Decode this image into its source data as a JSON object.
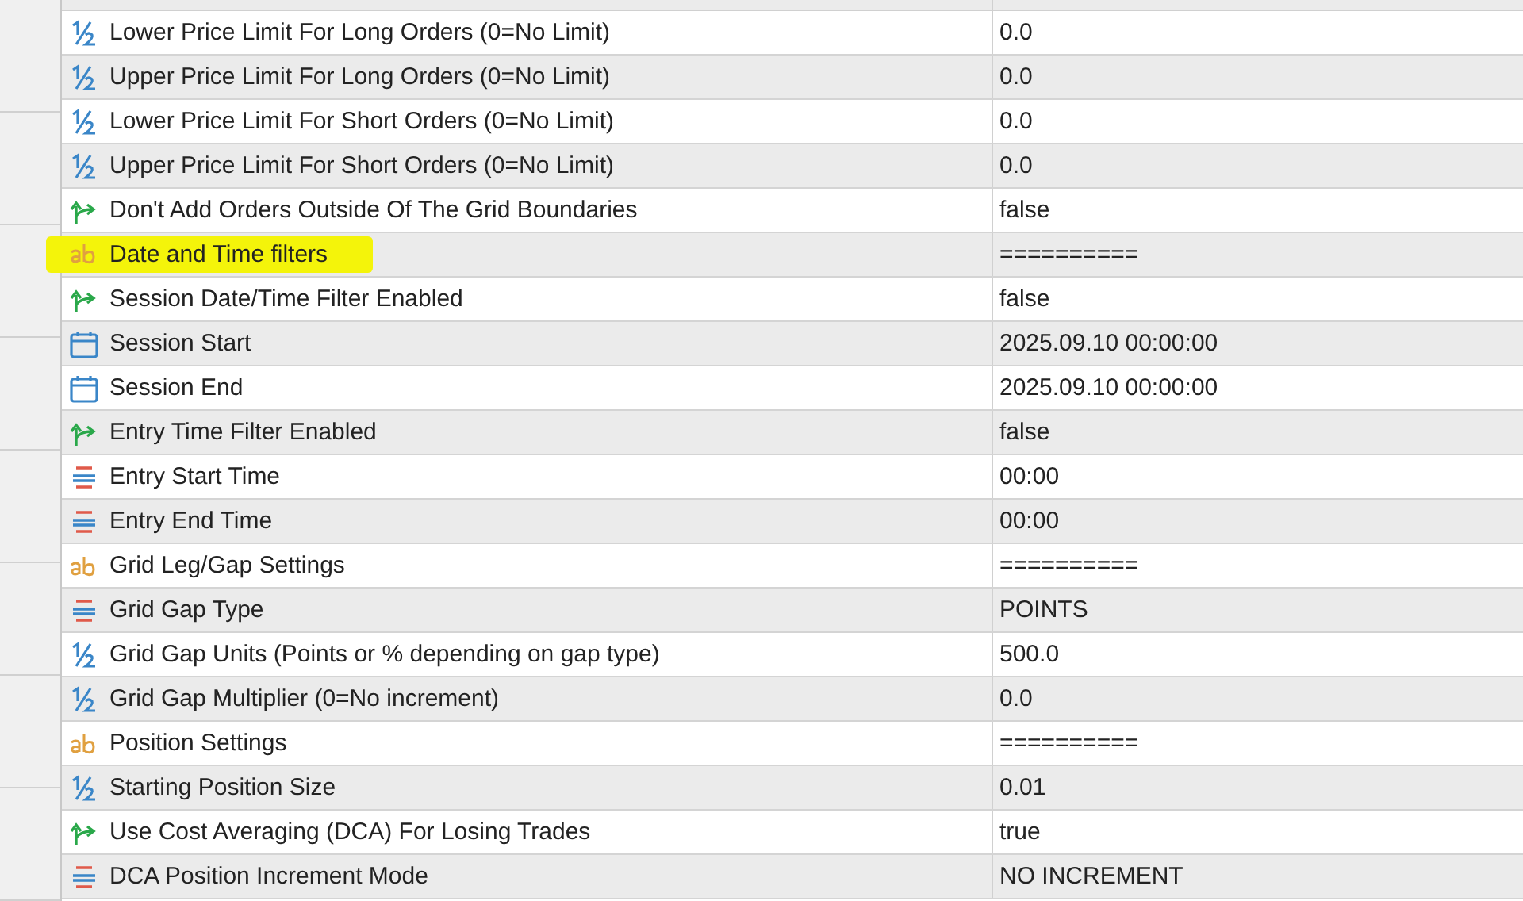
{
  "rows": [
    {
      "kind": "number",
      "name": "Lower Price Limit For Long Orders (0=No Limit)",
      "value": "0.0",
      "highlighted": false
    },
    {
      "kind": "number",
      "name": "Upper Price Limit For Long Orders (0=No Limit)",
      "value": "0.0",
      "highlighted": false
    },
    {
      "kind": "number",
      "name": "Lower Price Limit For Short Orders (0=No Limit)",
      "value": "0.0",
      "highlighted": false
    },
    {
      "kind": "number",
      "name": "Upper Price Limit For Short Orders (0=No Limit)",
      "value": "0.0",
      "highlighted": false
    },
    {
      "kind": "bool",
      "name": "Don't Add Orders Outside Of The Grid Boundaries",
      "value": "false",
      "highlighted": false
    },
    {
      "kind": "string",
      "name": "Date and Time filters",
      "value": "==========",
      "highlighted": true
    },
    {
      "kind": "bool",
      "name": "Session Date/Time Filter Enabled",
      "value": "false",
      "highlighted": false
    },
    {
      "kind": "datetime",
      "name": "Session Start",
      "value": "2025.09.10 00:00:00",
      "highlighted": false
    },
    {
      "kind": "datetime",
      "name": "Session End",
      "value": "2025.09.10 00:00:00",
      "highlighted": false
    },
    {
      "kind": "bool",
      "name": "Entry Time Filter Enabled",
      "value": "false",
      "highlighted": false
    },
    {
      "kind": "enum",
      "name": "Entry Start Time",
      "value": "00:00",
      "highlighted": false
    },
    {
      "kind": "enum",
      "name": "Entry End Time",
      "value": "00:00",
      "highlighted": false
    },
    {
      "kind": "string",
      "name": "Grid Leg/Gap Settings",
      "value": "==========",
      "highlighted": false
    },
    {
      "kind": "enum",
      "name": "Grid Gap Type",
      "value": "POINTS",
      "highlighted": false
    },
    {
      "kind": "number",
      "name": "Grid Gap Units (Points or % depending on gap type)",
      "value": "500.0",
      "highlighted": false
    },
    {
      "kind": "number",
      "name": "Grid Gap Multiplier (0=No increment)",
      "value": "0.0",
      "highlighted": false
    },
    {
      "kind": "string",
      "name": "Position Settings",
      "value": "==========",
      "highlighted": false
    },
    {
      "kind": "number",
      "name": "Starting Position Size",
      "value": "0.01",
      "highlighted": false
    },
    {
      "kind": "bool",
      "name": "Use Cost Averaging (DCA) For Losing Trades",
      "value": "true",
      "highlighted": false
    },
    {
      "kind": "enum",
      "name": "DCA Position Increment Mode",
      "value": "NO INCREMENT",
      "highlighted": false
    }
  ]
}
